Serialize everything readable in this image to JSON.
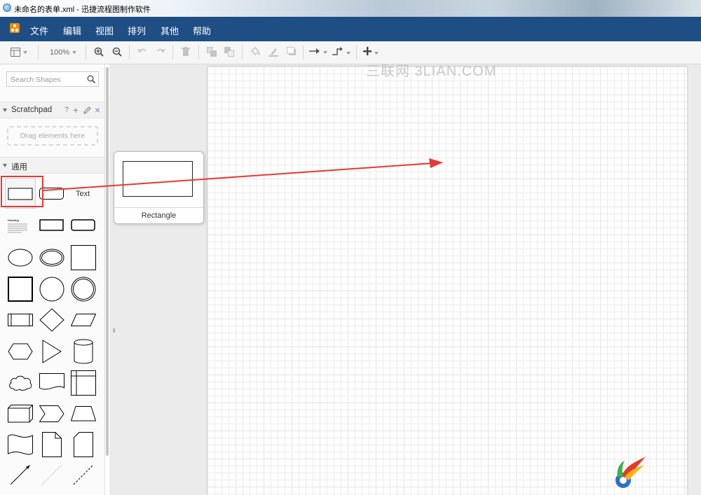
{
  "window": {
    "title": "未命名的表单.xml - 迅捷流程图制作软件"
  },
  "menu": {
    "items": [
      "文件",
      "编辑",
      "视图",
      "排列",
      "其他",
      "帮助"
    ]
  },
  "toolbar": {
    "zoom": "100%"
  },
  "sidebar": {
    "search_placeholder": "Search Shapes",
    "scratchpad_title": "Scratchpad",
    "scratchpad_help": "?",
    "scratchpad_add": "+",
    "scratchpad_close": "×",
    "drop_hint": "Drag elements here",
    "general_title": "通用",
    "text_shape_label": "Text",
    "heading_shape_label": "Heading"
  },
  "tooltip": {
    "shape_name": "Rectangle"
  },
  "watermark": "三联网 3LIAN.COM",
  "colors": {
    "menubar": "#1e4e84",
    "annotation_red": "#e53935",
    "logo_orange": "#f08705"
  }
}
